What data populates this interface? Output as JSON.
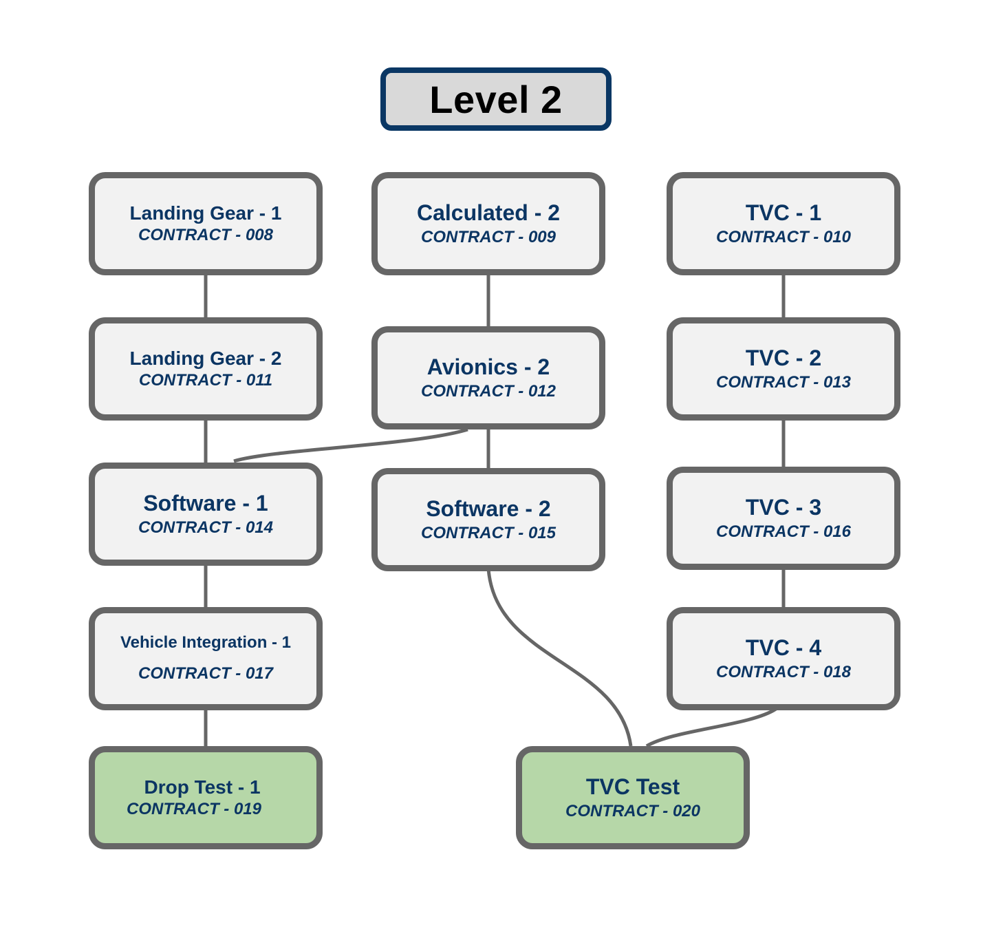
{
  "title": "Level 2",
  "colors": {
    "title_border": "#0a3764",
    "title_fill": "#d9d9d9",
    "node_border": "#666666",
    "node_fill": "#f2f2f2",
    "test_fill": "#b6d7a8",
    "text": "#0b3563"
  },
  "nodes": [
    {
      "id": "lg1",
      "name": "Landing Gear - 1",
      "contract": "CONTRACT - 008"
    },
    {
      "id": "cal2",
      "name": "Calculated - 2",
      "contract": "CONTRACT - 009"
    },
    {
      "id": "tvc1",
      "name": "TVC - 1",
      "contract": "CONTRACT - 010"
    },
    {
      "id": "lg2",
      "name": "Landing Gear - 2",
      "contract": "CONTRACT - 011"
    },
    {
      "id": "av2",
      "name": "Avionics - 2",
      "contract": "CONTRACT - 012"
    },
    {
      "id": "tvc2",
      "name": "TVC - 2",
      "contract": "CONTRACT - 013"
    },
    {
      "id": "sw1",
      "name": "Software - 1",
      "contract": "CONTRACT - 014"
    },
    {
      "id": "sw2",
      "name": "Software - 2",
      "contract": "CONTRACT - 015"
    },
    {
      "id": "tvc3",
      "name": "TVC - 3",
      "contract": "CONTRACT - 016"
    },
    {
      "id": "vi1",
      "name": "Vehicle Integration - 1",
      "contract": "CONTRACT - 017"
    },
    {
      "id": "tvc4",
      "name": "TVC - 4",
      "contract": "CONTRACT - 018"
    },
    {
      "id": "dt1",
      "name": "Drop Test - 1",
      "contract": "CONTRACT - 019",
      "type": "test"
    },
    {
      "id": "tvct",
      "name": "TVC Test",
      "contract": "CONTRACT - 020",
      "type": "test"
    }
  ],
  "edges": [
    {
      "from": "lg1",
      "to": "lg2"
    },
    {
      "from": "lg2",
      "to": "sw1"
    },
    {
      "from": "av2",
      "to": "sw1"
    },
    {
      "from": "sw1",
      "to": "vi1"
    },
    {
      "from": "vi1",
      "to": "dt1"
    },
    {
      "from": "cal2",
      "to": "av2"
    },
    {
      "from": "av2",
      "to": "sw2"
    },
    {
      "from": "sw2",
      "to": "tvct"
    },
    {
      "from": "tvc1",
      "to": "tvc2"
    },
    {
      "from": "tvc2",
      "to": "tvc3"
    },
    {
      "from": "tvc3",
      "to": "tvc4"
    },
    {
      "from": "tvc4",
      "to": "tvct"
    }
  ]
}
